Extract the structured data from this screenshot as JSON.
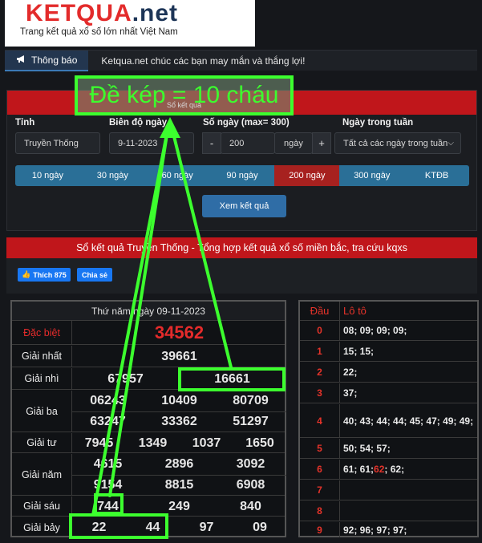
{
  "logo": {
    "k": "K",
    "e": "E",
    "t": "T",
    "q": "Q",
    "u": "U",
    "a": "A",
    "net": ".net",
    "o": "O",
    "slogan": "Trang kết quả xổ số lớn nhất Việt Nam"
  },
  "notice": {
    "tab_label": "Thông báo",
    "text": "Ketqua.net chúc các bạn may mắn và thắng lợi!"
  },
  "annotation": {
    "text": "Đề kép = 10 cháu",
    "underlying_text": "Sổ kết quả"
  },
  "form": {
    "labels": {
      "province": "Tỉnh",
      "date": "Biên độ ngày",
      "days": "Số ngày (max= 300)",
      "weekday": "Ngày trong tuần"
    },
    "province_value": "Truyền Thống",
    "date_value": "9-11-2023",
    "minus": "-",
    "days_value": "200",
    "days_unit": "ngày",
    "plus": "+",
    "weekday_value": "Tất cả các ngày trong tuần",
    "ranges": [
      "10 ngày",
      "30 ngày",
      "60 ngày",
      "90 ngày",
      "200 ngày",
      "300 ngày",
      "KTĐB"
    ],
    "active_range": "200 ngày",
    "submit": "Xem kết quả"
  },
  "section_title": "Sổ kết quả Truyền Thống - Tổng hợp kết quả xổ số miền bắc, tra cứu kqxs",
  "social": {
    "like": "Thích 875",
    "share": "Chia sẻ"
  },
  "results": {
    "date": "Thứ năm ngày 09-11-2023",
    "db_label": "Đặc biệt",
    "db": "34562",
    "g1_label": "Giải nhất",
    "g1": "39661",
    "g2_label": "Giải nhì",
    "g2": [
      "67957",
      "16661"
    ],
    "g3_label": "Giải ba",
    "g3": [
      "06243",
      "10409",
      "80709",
      "63247",
      "33362",
      "51297"
    ],
    "g4_label": "Giải tư",
    "g4": [
      "7945",
      "1349",
      "1037",
      "1650"
    ],
    "g5_label": "Giải năm",
    "g5": [
      "4615",
      "2896",
      "3092",
      "9154",
      "8815",
      "6908"
    ],
    "g6_label": "Giải sáu",
    "g6": [
      "744",
      "249",
      "840"
    ],
    "g7_label": "Giải bảy",
    "g7": [
      "22",
      "44",
      "97",
      "09"
    ]
  },
  "loto": {
    "head_dau": "Đầu",
    "head_loto": "Lô tô",
    "rows": [
      {
        "d": "0",
        "l": "08; 09; 09; 09;"
      },
      {
        "d": "1",
        "l": "15; 15;"
      },
      {
        "d": "2",
        "l": "22;"
      },
      {
        "d": "3",
        "l": "37;"
      },
      {
        "d": "4",
        "l": "40; 43; 44; 44; 45; 47; 49; 49;"
      },
      {
        "d": "5",
        "l": "50; 54; 57;"
      },
      {
        "d": "6",
        "l_a": "61; 61; ",
        "l_red": "62",
        "l_b": "; 62;"
      },
      {
        "d": "7",
        "l": ""
      },
      {
        "d": "8",
        "l": ""
      },
      {
        "d": "9",
        "l": "92; 96; 97; 97;"
      }
    ]
  },
  "colors": {
    "annotation": "#3cff2e",
    "accent_red": "#c0161b",
    "button_blue": "#2a6f97"
  }
}
